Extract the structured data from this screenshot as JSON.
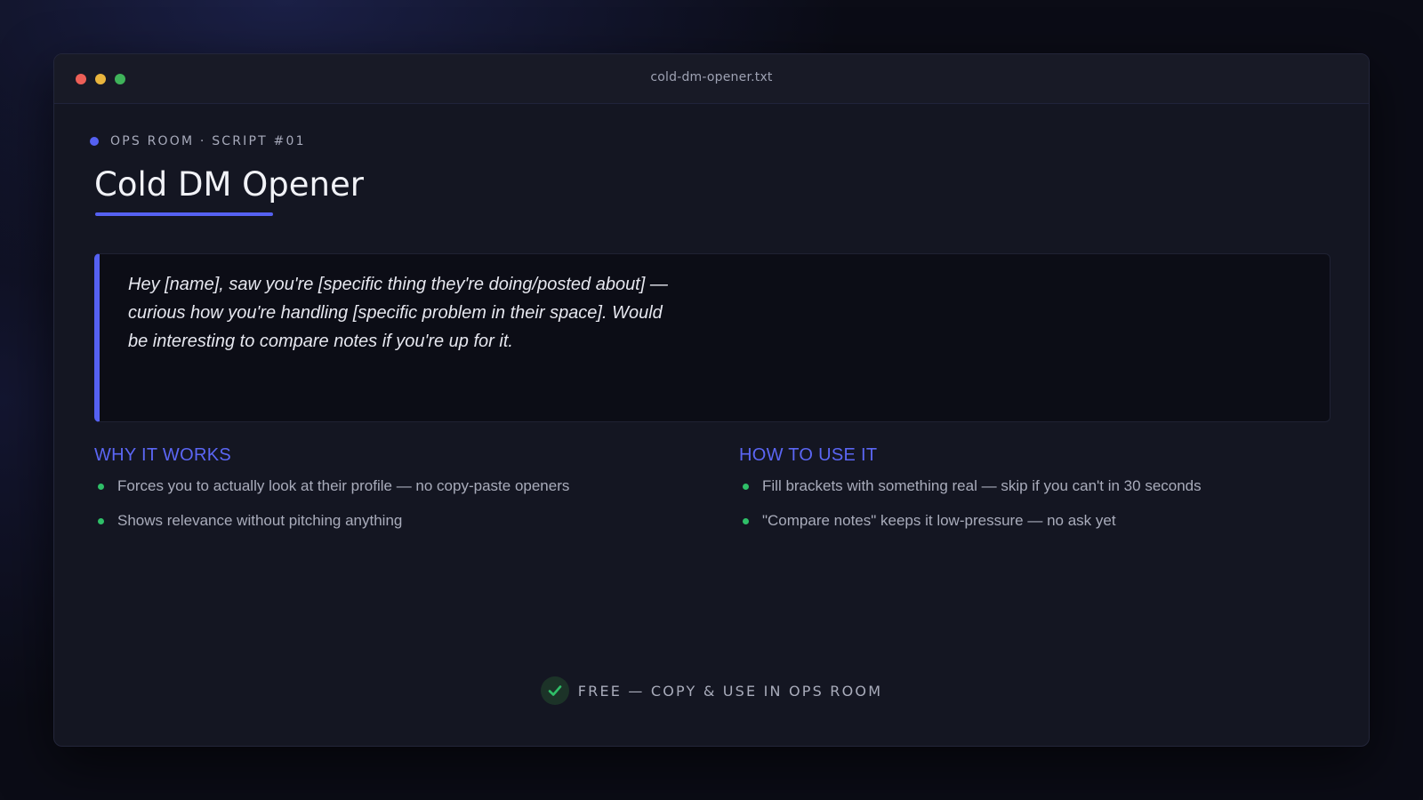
{
  "window": {
    "filename": "cold-dm-opener.txt"
  },
  "header": {
    "eyebrow": "OPS ROOM · SCRIPT #01",
    "title": "Cold DM Opener"
  },
  "script": {
    "text": "Hey [name], saw you're [specific thing they're doing/posted about] — curious how you're handling [specific problem in their space]. Would be interesting to compare notes if you're up for it."
  },
  "why_it_works": {
    "heading": "WHY IT WORKS",
    "items": [
      "Forces you to actually look at their profile — no copy-paste openers",
      "Shows relevance without pitching anything"
    ]
  },
  "how_to_use": {
    "heading": "HOW TO USE IT",
    "items": [
      "Fill brackets with something real — skip if you can't in 30 seconds",
      "\"Compare notes\" keeps it low-pressure — no ask yet"
    ]
  },
  "footer": {
    "label": "FREE — COPY & USE IN OPS ROOM",
    "icon": "check-icon"
  },
  "colors": {
    "accent": "#5561f2",
    "bullet": "#2fbf68",
    "background": "#141622"
  }
}
